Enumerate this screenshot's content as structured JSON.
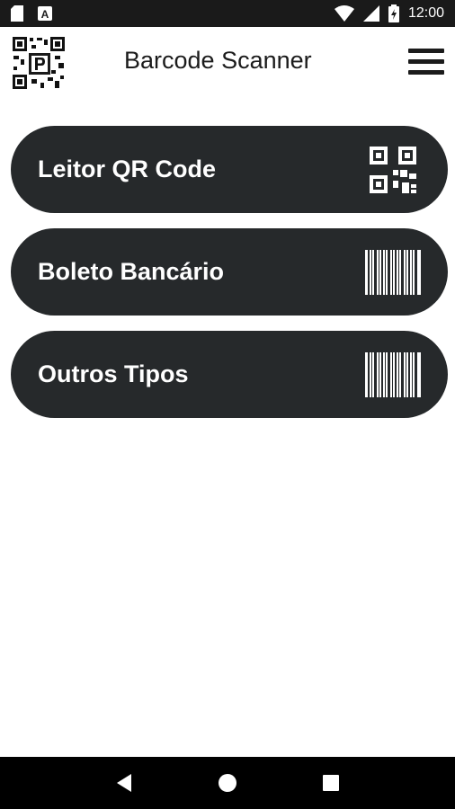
{
  "status_bar": {
    "time": "12:00",
    "icons": [
      "sd-card-icon",
      "a-badge-icon",
      "wifi-icon",
      "signal-icon",
      "battery-icon"
    ]
  },
  "app_bar": {
    "title": "Barcode Scanner",
    "logo": "qr-logo-icon",
    "menu_icon": "hamburger-menu-icon"
  },
  "buttons": [
    {
      "label": "Leitor QR Code",
      "icon": "qr-code-icon"
    },
    {
      "label": "Boleto Bancário",
      "icon": "barcode-icon"
    },
    {
      "label": "Outros Tipos",
      "icon": "barcode-icon"
    }
  ],
  "nav_bar": {
    "icons": [
      "back-icon",
      "home-icon",
      "recents-icon"
    ]
  },
  "colors": {
    "button_bg": "#26292b",
    "status_bar_bg": "#1a1a1a",
    "nav_bar_bg": "#000000"
  }
}
